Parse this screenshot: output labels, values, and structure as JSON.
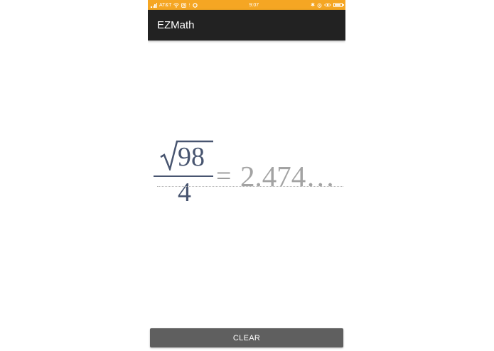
{
  "status_bar": {
    "carrier": "AT&T",
    "time": "9:07",
    "background_color": "#f5a623",
    "left_icons": [
      "signal-icon",
      "wifi-icon",
      "instagram-icon",
      "notification-icon",
      "sync-icon"
    ],
    "right_icons": [
      "bluetooth-icon",
      "alarm-icon",
      "eye-icon",
      "battery-icon"
    ]
  },
  "app_bar": {
    "title": "EZMath",
    "background_color": "#222222"
  },
  "math": {
    "expression": {
      "radical_symbol": "√",
      "numerator_radicand": "98",
      "denominator": "4"
    },
    "equals_sign": "=",
    "result": "2.474…",
    "expression_color": "#485570",
    "result_color": "#a3a3a3"
  },
  "clear_button": {
    "label": "CLEAR",
    "background_color": "#5f5f5f"
  }
}
